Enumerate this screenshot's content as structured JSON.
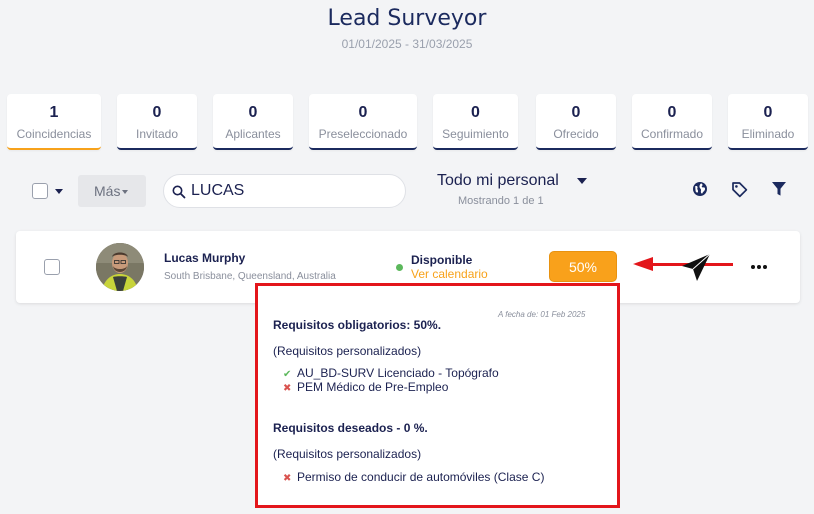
{
  "header": {
    "title": "Lead Surveyor",
    "date_range": "01/01/2025 - 31/03/2025"
  },
  "stages": [
    {
      "count": "1",
      "label": "Coincidencias",
      "active": true
    },
    {
      "count": "0",
      "label": "Invitado"
    },
    {
      "count": "0",
      "label": "Aplicantes"
    },
    {
      "count": "0",
      "label": "Preseleccionado"
    },
    {
      "count": "0",
      "label": "Seguimiento"
    },
    {
      "count": "0",
      "label": "Ofrecido"
    },
    {
      "count": "0",
      "label": "Confirmado"
    },
    {
      "count": "0",
      "label": "Eliminado"
    }
  ],
  "toolbar": {
    "more_label": "Más",
    "search_value": "LUCAS",
    "staff_filter": "Todo mi personal",
    "showing": "Mostrando 1 de 1",
    "icons": [
      "globe-icon",
      "tag-icon",
      "filter-icon"
    ]
  },
  "candidate": {
    "name": "Lucas Murphy",
    "location": "South Brisbane, Queensland, Australia",
    "status": "Disponible",
    "calendar_link": "Ver calendario",
    "match_percent": "50%"
  },
  "popover": {
    "as_of": "A fecha de: 01 Feb 2025",
    "mandatory_title": "Requisitos obligatorios: 50%.",
    "mandatory_sub": "(Requisitos personalizados)",
    "mandatory_items": [
      {
        "mark": "✔",
        "text": "AU_BD-SURV Licenciado - Topógrafo",
        "met": true
      },
      {
        "mark": "✖",
        "text": "PEM Médico de Pre-Empleo",
        "met": false
      }
    ],
    "desired_title": "Requisitos deseados - 0 %.",
    "desired_sub": "(Requisitos personalizados)",
    "desired_items": [
      {
        "mark": "✖",
        "text": "Permiso de conducir de automóviles (Clase C)",
        "met": false
      }
    ]
  },
  "colors": {
    "accent": "#f9a11b",
    "navy": "#1b2a5e",
    "annotation_red": "#e3161b",
    "available_green": "#5cb85c"
  }
}
